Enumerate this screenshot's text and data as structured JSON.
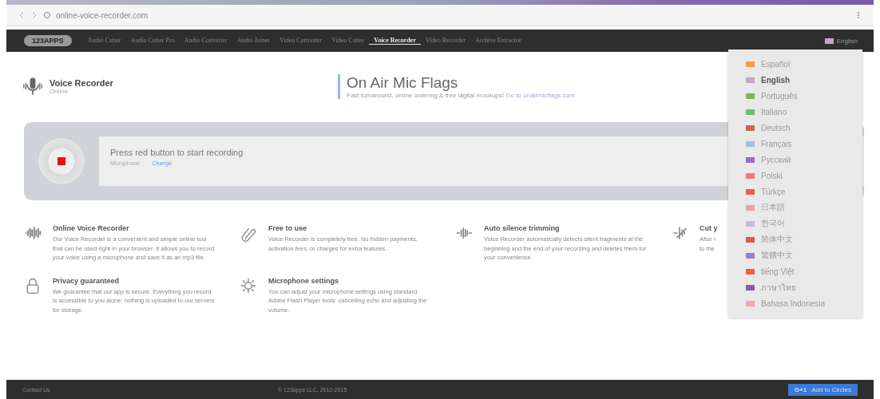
{
  "browser": {
    "address": "online-voice-recorder.com"
  },
  "nav": {
    "logo": "123APPS",
    "items": [
      {
        "label": "Audio Cutter",
        "selected": false
      },
      {
        "label": "Audio Cutter Pro",
        "selected": false
      },
      {
        "label": "Audio Converter",
        "selected": false
      },
      {
        "label": "Audio Joiner",
        "selected": false
      },
      {
        "label": "Video Converter",
        "selected": false
      },
      {
        "label": "Video Cutter",
        "selected": false
      },
      {
        "label": "Voice Recorder",
        "selected": true
      },
      {
        "label": "Video Recorder",
        "selected": false
      },
      {
        "label": "Archive Extractor",
        "selected": false
      }
    ],
    "language": "English"
  },
  "languages": [
    {
      "label": "Español",
      "color": "#f39a4a",
      "selected": false
    },
    {
      "label": "English",
      "color": "#c9a3c6",
      "selected": true
    },
    {
      "label": "Português",
      "color": "#7fb25a",
      "selected": false
    },
    {
      "label": "Italiano",
      "color": "#6cbf6c",
      "selected": false
    },
    {
      "label": "Deutsch",
      "color": "#c46a4a",
      "selected": false
    },
    {
      "label": "Français",
      "color": "#9ec0e8",
      "selected": false
    },
    {
      "label": "Русский",
      "color": "#a06ac0",
      "selected": false
    },
    {
      "label": "Polski",
      "color": "#f07a7a",
      "selected": false
    },
    {
      "label": "Türkçe",
      "color": "#f05a5a",
      "selected": false
    },
    {
      "label": "日本語",
      "color": "#f0a0a0",
      "selected": false
    },
    {
      "label": "한국어",
      "color": "#c8b8d8",
      "selected": false
    },
    {
      "label": "简体中文",
      "color": "#e05a4a",
      "selected": false
    },
    {
      "label": "繁體中文",
      "color": "#9a7ad0",
      "selected": false
    },
    {
      "label": "tiếng Việt",
      "color": "#f06040",
      "selected": false
    },
    {
      "label": "ภาษาไทย",
      "color": "#8a5aa8",
      "selected": false
    },
    {
      "label": "Bahasa Indonesia",
      "color": "#f0a8a8",
      "selected": false
    }
  ],
  "app": {
    "title": "Voice Recorder",
    "subtitle": "Online"
  },
  "ad": {
    "title": "On Air Mic Flags",
    "text": "Fast turnaround, online ordering & free digital mockups!",
    "link": "Go to onairmicflags.com"
  },
  "recorder": {
    "prompt": "Press red button to start recording",
    "mic_label": "Microphone:",
    "change": "Change"
  },
  "features": [
    {
      "kind": "wave",
      "title": "Online Voice Recorder",
      "text": "Our Voice Recorder is a convenient and simple online tool that can be used right in your browser. It allows you to record your voice using a microphone and save it as an mp3 file."
    },
    {
      "kind": "clip",
      "title": "Free to use",
      "text": "Voice Recorder is completely free. No hidden payments, activation fees, or charges for extra features."
    },
    {
      "kind": "trim",
      "title": "Auto silence trimming",
      "text": "Voice Recorder automatically detects silent fragments at the beginning and the end of your recording and deletes them for your convenience."
    },
    {
      "kind": "cut",
      "title": "Cut y",
      "text": "After r to the"
    },
    {
      "kind": "lock",
      "title": "Privacy guaranteed",
      "text": "We guarantee that our app is secure. Everything you record is accessible to you alone: nothing is uploaded to our servers for storage."
    },
    {
      "kind": "gear",
      "title": "Microphone settings",
      "text": "You can adjust your microphone settings using standard Adobe Flash Player tools: cancelling echo and adjusting the volume."
    }
  ],
  "footer": {
    "contact": "Contact Us",
    "copyright": "© 123apps LLC, 2012-2015",
    "circles_badge": "G+1",
    "circles": "Add to Circles"
  }
}
